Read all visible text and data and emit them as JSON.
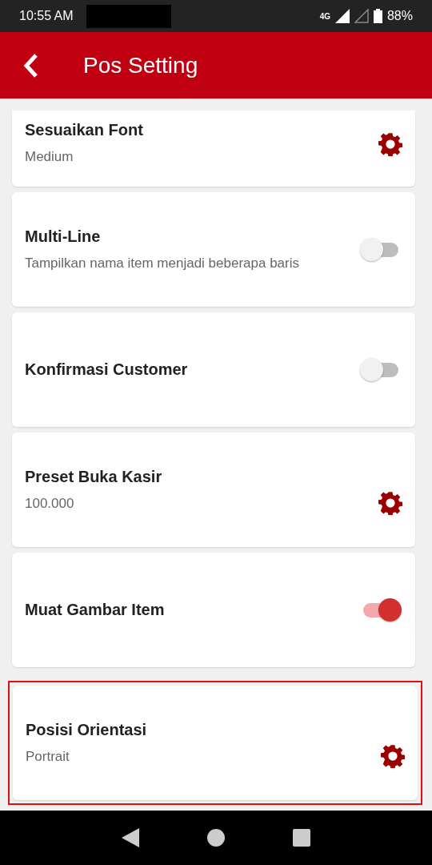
{
  "status_bar": {
    "time": "10:55 AM",
    "network": "4G",
    "battery": "88%"
  },
  "app_bar": {
    "title": "Pos Setting"
  },
  "settings": [
    {
      "kind": "gear",
      "title": "Sesuaikan Font",
      "subtitle": "Medium",
      "highlighted": false
    },
    {
      "kind": "toggle",
      "title": "Multi-Line",
      "subtitle": "Tampilkan nama item menjadi beberapa baris",
      "on": false,
      "highlighted": false
    },
    {
      "kind": "toggle",
      "title": "Konfirmasi Customer",
      "on": false,
      "highlighted": false
    },
    {
      "kind": "gear",
      "title": "Preset Buka Kasir",
      "subtitle": "100.000",
      "highlighted": false
    },
    {
      "kind": "toggle",
      "title": "Muat Gambar Item",
      "on": true,
      "highlighted": false
    },
    {
      "kind": "gear",
      "title": "Posisi Orientasi",
      "subtitle": "Portrait",
      "highlighted": true
    }
  ]
}
